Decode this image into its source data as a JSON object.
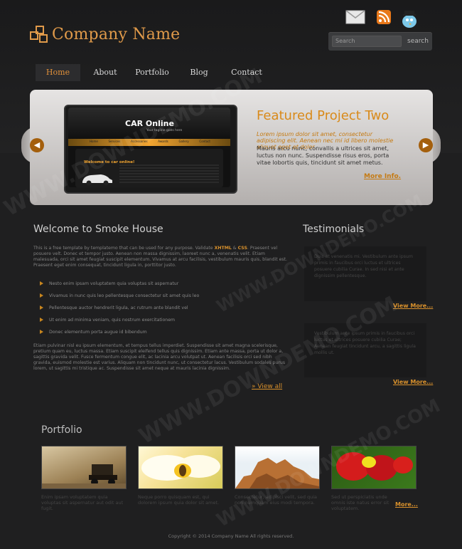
{
  "header": {
    "company_name": "Company Name",
    "search_placeholder": "Search",
    "search_button": "search",
    "icons": [
      "envelope-icon",
      "rss-icon",
      "bird-icon"
    ]
  },
  "nav": {
    "items": [
      {
        "label": "Home",
        "active": true
      },
      {
        "label": "About"
      },
      {
        "label": "Portfolio"
      },
      {
        "label": "Blog"
      },
      {
        "label": "Contact"
      }
    ]
  },
  "slider": {
    "thumb_title": "CAR Online",
    "thumb_tagline": "Your tagline goes here",
    "thumb_nav": [
      "Home",
      "Services",
      "Accessories",
      "Awards",
      "Gallery",
      "Contact"
    ],
    "thumb_welcome": "Welcome to car online!",
    "title": "Featured Project Two",
    "italic": "Lorem ipsum dolor sit amet, consectetur adipiscing elit. Aenean nec mi id libero molestie aliquet eget et dolor.",
    "body": "Mauris arcu nunc, convallis a ultrices sit amet, luctus non nunc. Suspendisse risus eros, porta vitae lobortis quis, tincidunt sit amet metus.",
    "more_link": "More Info."
  },
  "welcome": {
    "title": "Welcome to Smoke House",
    "p1_start": "This is a free template by templatemo that can be used for any purpose. Validate ",
    "xhtml": "XHTML",
    "amp": " & ",
    "css": "CSS",
    "p1_end": ". Praesent vel posuere velt. Donec et tempor justo. Aenean non massa dignissim, laoreet nunc a, venenatis velit. Etiam malesuada, orci sit amet feugiat suscipit elementum. Vivamus at arcu facilisis, vestibulum mauris quis, blandit est. Praesent eget enim consequat, tincidunt ligula in, porttitor justo.",
    "bullets": [
      "Nesto enim ipsam voluptatem quia voluptas sit aspernatur",
      "Vivamus in nunc quis leo pellentesque consectetur sit amet quis leo",
      "Pellentesque auctor hendrerit ligula, ac rutrum ante blandit vel",
      "Ut enim ad minima veniam, quis nostrum exercitationem",
      "Donec elementum porta augue id bibendum"
    ],
    "p2": "Etiam pulvinar nisl eu ipsum elementum, et tempus tellus imperdiet. Suspendisse sit amet magna scelerisque, pretium quam eu, luctus massa. Etiam suscipit eleifend tellus quis dignissim. Etiam ante massa, porta ut dolor a, sagittis gravida velit. Fusce fermentum congue elit, ac lacinia arcu volutpat ut. Aenean facilisis orci sed nibh gravida, euismod molestie est varius. Aliquam non tincidunt nunc, ut consectetur lacus. Vestibulum sodales purus lorem, ut sagittis mi tristique ac. Suspendisse sit amet neque at mauris lacinia dignissim.",
    "view_all": "» View all"
  },
  "testimonials": {
    "title": "Testimonials",
    "items": [
      {
        "text": "Duis at venenatis mi. Vestibulum ante ipsum primis in faucibus orci luctus et ultrices posuere cubilia Curae. In sed nisi et ante dignissim pellentesque.",
        "more": "View More..."
      },
      {
        "text": "Vestibulum ante ipsum primis in faucibus orci luctus et ultrices posuere cubilia Curae; Aenean feugiat tincidunt arcu, a sagittis ligula mollis ut.",
        "more": "View More..."
      }
    ]
  },
  "portfolio": {
    "title": "Portfolio",
    "items": [
      {
        "caption": "Enim ipsam voluptatem quia voluptas sit aspernatur aut odit aut fugit."
      },
      {
        "caption": "Neque porro quisquam est, qui dolorem ipsum quia dolor sit amet."
      },
      {
        "caption": "Consectetur, adipisci velit, sed quia non numquam eius modi tempora."
      },
      {
        "caption": "Sed ut perspiciatis unde omnis iste natus error sit voluptatem."
      }
    ],
    "more": "More..."
  },
  "footer": {
    "text": "Copyright © 2014 Company Name All rights reserved."
  },
  "watermark": {
    "text": "WWW.DOWNDEMO.COM"
  },
  "colors": {
    "accent": "#d9912c",
    "background": "#1f1f20"
  }
}
